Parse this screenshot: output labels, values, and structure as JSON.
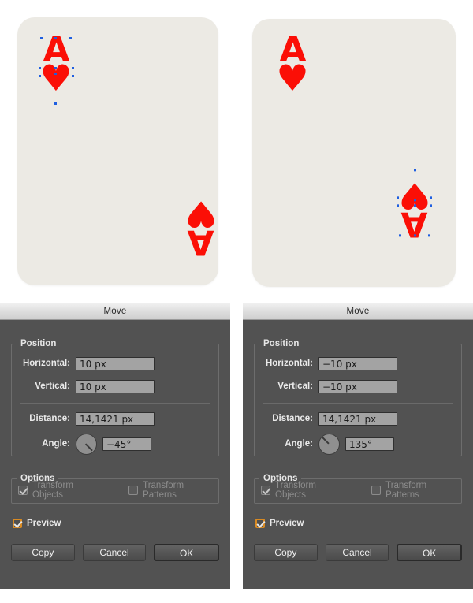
{
  "canvas": {
    "cards": [
      {
        "id": "card-original",
        "background_color": "#eceae4",
        "marks": [
          {
            "position": "top-left",
            "letter": "A",
            "suit": "♥",
            "suit_name": "heart",
            "selected": true
          },
          {
            "position": "bottom-right",
            "letter": "A",
            "suit": "♥",
            "suit_name": "heart",
            "selected": false,
            "rotated": true
          }
        ]
      },
      {
        "id": "card-moved",
        "background_color": "#eceae4",
        "marks": [
          {
            "position": "top-left",
            "letter": "A",
            "suit": "♥",
            "suit_name": "heart",
            "selected": false
          },
          {
            "position": "bottom-right",
            "letter": "A",
            "suit": "♥",
            "suit_name": "heart",
            "selected": true,
            "rotated": true
          }
        ]
      }
    ],
    "art_color": "#fb0f06",
    "anchor_color": "#1f5fe0"
  },
  "dialogs": [
    {
      "id": "move-dialog-left",
      "title": "Move",
      "position_group": {
        "legend": "Position",
        "horizontal_label": "Horizontal:",
        "horizontal_value": "10 px",
        "vertical_label": "Vertical:",
        "vertical_value": "10 px",
        "distance_label": "Distance:",
        "distance_value": "14,1421 px",
        "angle_label": "Angle:",
        "angle_value": "−45°",
        "angle_degrees": -45
      },
      "options_group": {
        "legend": "Options",
        "transform_objects_label": "Transform Objects",
        "transform_objects_checked": true,
        "transform_objects_enabled": false,
        "transform_patterns_label": "Transform Patterns",
        "transform_patterns_checked": false,
        "transform_patterns_enabled": false
      },
      "preview_label": "Preview",
      "preview_checked": true,
      "buttons": [
        {
          "label": "Copy",
          "default": false
        },
        {
          "label": "Cancel",
          "default": false
        },
        {
          "label": "OK",
          "default": true
        }
      ]
    },
    {
      "id": "move-dialog-right",
      "title": "Move",
      "position_group": {
        "legend": "Position",
        "horizontal_label": "Horizontal:",
        "horizontal_value": "−10 px",
        "vertical_label": "Vertical:",
        "vertical_value": "−10 px",
        "distance_label": "Distance:",
        "distance_value": "14,1421 px",
        "angle_label": "Angle:",
        "angle_value": "135°",
        "angle_degrees": 135
      },
      "options_group": {
        "legend": "Options",
        "transform_objects_label": "Transform Objects",
        "transform_objects_checked": true,
        "transform_objects_enabled": false,
        "transform_patterns_label": "Transform Patterns",
        "transform_patterns_checked": false,
        "transform_patterns_enabled": false
      },
      "preview_label": "Preview",
      "preview_checked": true,
      "buttons": [
        {
          "label": "Copy",
          "default": false
        },
        {
          "label": "Cancel",
          "default": false
        },
        {
          "label": "OK",
          "default": true
        }
      ]
    }
  ],
  "colors": {
    "dialog_background": "#525252",
    "field_background": "#a3a3a3",
    "focus_accent": "#d98a22",
    "titlebar_text": "#2a2a2a"
  }
}
